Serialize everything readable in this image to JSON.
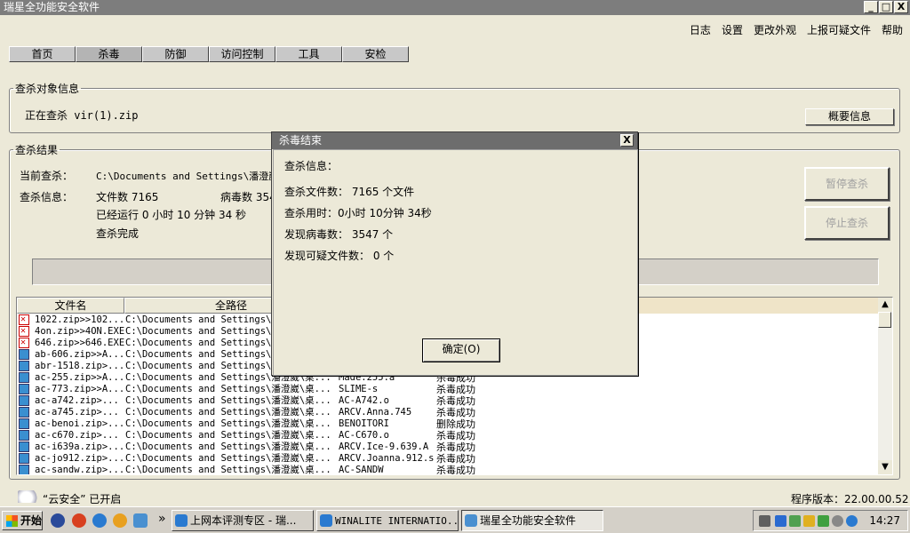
{
  "window": {
    "title": "瑞星全功能安全软件",
    "min": "_",
    "max": "□",
    "close": "X"
  },
  "top_menu": [
    "日志",
    "设置",
    "更改外观",
    "上报可疑文件",
    "帮助"
  ],
  "nav_tabs": [
    "首页",
    "杀毒",
    "防御",
    "访问控制",
    "工具",
    "安检"
  ],
  "scan_target": {
    "legend": "查杀对象信息",
    "current": "正在查杀 vir(1).zip",
    "summary_button": "概要信息"
  },
  "scan_result": {
    "legend": "查杀结果",
    "current_label": "当前查杀：",
    "current_path": "C:\\Documents and Settings\\潘澄崴\\",
    "info_label": "查杀信息：",
    "file_count": "文件数 7165",
    "virus_count": "病毒数 354",
    "elapsed": "已经运行 0 小时 10 分钟 34  秒",
    "status": "查杀完成",
    "pause_button": "暂停查杀",
    "stop_button": "停止查杀"
  },
  "grid": {
    "columns": [
      "文件名",
      "全路径"
    ],
    "rows": [
      {
        "name": "1022.zip>>102...",
        "path": "C:\\Documents and Settings\\潘",
        "virus": "",
        "result": "",
        "icon": "bad"
      },
      {
        "name": "4on.zip>>4ON.EXE",
        "path": "C:\\Documents and Settings\\潘",
        "virus": "",
        "result": "",
        "icon": "bad"
      },
      {
        "name": "646.zip>>646.EXE",
        "path": "C:\\Documents and Settings\\潘",
        "virus": "",
        "result": "",
        "icon": "bad"
      },
      {
        "name": "ab-606.zip>>A...",
        "path": "C:\\Documents and Settings\\潘",
        "virus": "",
        "result": "",
        "icon": "ok"
      },
      {
        "name": "abr-1518.zip>...",
        "path": "C:\\Documents and Settings\\潘",
        "virus": "",
        "result": "",
        "icon": "ok"
      },
      {
        "name": "ac-255.zip>>A...",
        "path": "C:\\Documents and Settings\\潘澄崴\\桌...",
        "virus": "Made.255.a",
        "result": "杀毒成功",
        "icon": "ok"
      },
      {
        "name": "ac-773.zip>>A...",
        "path": "C:\\Documents and Settings\\潘澄崴\\桌...",
        "virus": "SLIME-s",
        "result": "杀毒成功",
        "icon": "ok"
      },
      {
        "name": "ac-a742.zip>...",
        "path": "C:\\Documents and Settings\\潘澄崴\\桌...",
        "virus": "AC-A742.o",
        "result": "杀毒成功",
        "icon": "ok"
      },
      {
        "name": "ac-a745.zip>...",
        "path": "C:\\Documents and Settings\\潘澄崴\\桌...",
        "virus": "ARCV.Anna.745",
        "result": "杀毒成功",
        "icon": "ok"
      },
      {
        "name": "ac-benoi.zip>...",
        "path": "C:\\Documents and Settings\\潘澄崴\\桌...",
        "virus": "BENOITORI",
        "result": "删除成功",
        "icon": "ok"
      },
      {
        "name": "ac-c670.zip>...",
        "path": "C:\\Documents and Settings\\潘澄崴\\桌...",
        "virus": "AC-C670.o",
        "result": "杀毒成功",
        "icon": "ok"
      },
      {
        "name": "ac-i639a.zip>...",
        "path": "C:\\Documents and Settings\\潘澄崴\\桌...",
        "virus": "ARCV.Ice-9.639.A",
        "result": "杀毒成功",
        "icon": "ok"
      },
      {
        "name": "ac-jo912.zip>...",
        "path": "C:\\Documents and Settings\\潘澄崴\\桌...",
        "virus": "ARCV.Joanna.912.s",
        "result": "杀毒成功",
        "icon": "ok"
      },
      {
        "name": "ac-sandw.zip>...",
        "path": "C:\\Documents and Settings\\潘澄崴\\桌...",
        "virus": "AC-SANDW",
        "result": "杀毒成功",
        "icon": "ok"
      }
    ]
  },
  "dialog": {
    "title": "杀毒结束",
    "close": "X",
    "info_header": "查杀信息：",
    "files": "查杀文件数：  7165 个文件",
    "time": "查杀用时：0小时 10分钟 34秒",
    "viruses": "发现病毒数：   3547 个",
    "suspicious": "发现可疑文件数：  0 个",
    "ok_button": "确定(O)"
  },
  "status": {
    "cloud": "“云安全” 已开启",
    "version": "程序版本：22.00.00.52"
  },
  "taskbar": {
    "start": "开始",
    "chevron": "»",
    "tasks": [
      "上网本评测专区 - 瑞...",
      "WINALITE INTERNATIO...",
      "瑞星全功能安全软件"
    ],
    "clock": "14:27"
  },
  "colors": {
    "title_bg": "#7d7d7d",
    "dialog_title_bg": "#6d6d6d",
    "bg": "#ece9d8"
  }
}
